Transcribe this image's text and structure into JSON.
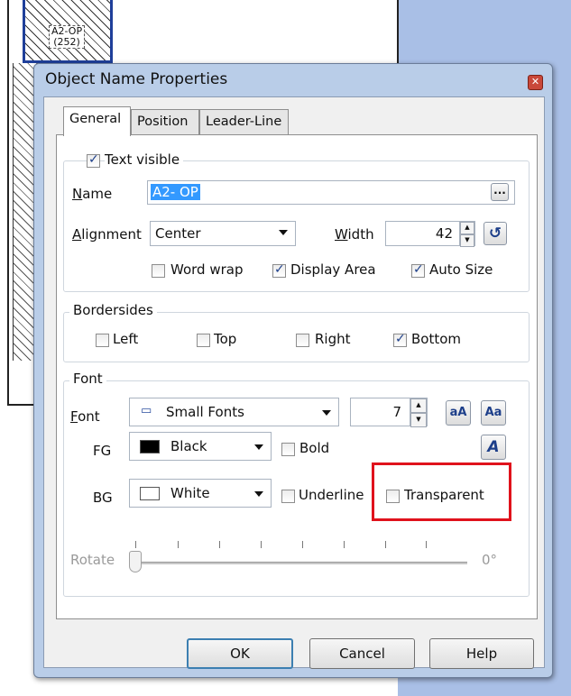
{
  "background": {
    "room_label_line1": "A2-OP",
    "room_label_line2": "(252)"
  },
  "dialog": {
    "title": "Object Name Properties",
    "close_icon": "close-icon"
  },
  "tabs": [
    {
      "label": "General",
      "active": true
    },
    {
      "label": "Position",
      "active": false
    },
    {
      "label": "Leader-Line",
      "active": false
    }
  ],
  "text_group": {
    "text_visible_label": "Text visible",
    "text_visible_checked": true,
    "name_label": "Name",
    "name_value": "A2- OP",
    "browse_label": "...",
    "alignment_label": "Alignment",
    "alignment_value": "Center",
    "width_label": "Width",
    "width_value": "42",
    "reset_icon": "refresh-icon",
    "word_wrap_label": "Word wrap",
    "word_wrap_checked": false,
    "display_area_label": "Display Area",
    "display_area_checked": true,
    "auto_size_label": "Auto Size",
    "auto_size_checked": true
  },
  "bordersides": {
    "title": "Bordersides",
    "left_label": "Left",
    "left_checked": false,
    "top_label": "Top",
    "top_checked": false,
    "right_label": "Right",
    "right_checked": false,
    "bottom_label": "Bottom",
    "bottom_checked": true
  },
  "font_group": {
    "title": "Font",
    "font_label": "Font",
    "font_value": "Small Fonts",
    "font_icon": "font-icon",
    "size_value": "7",
    "grow_icon": "font-grow-icon",
    "shrink_icon": "font-shrink-icon",
    "italic_icon": "font-style-icon",
    "fg_label": "FG",
    "fg_value": "Black",
    "fg_color": "#000000",
    "bold_label": "Bold",
    "bold_checked": false,
    "bg_label": "BG",
    "bg_value": "White",
    "bg_color": "#ffffff",
    "underline_label": "Underline",
    "underline_checked": false,
    "transparent_label": "Transparent",
    "transparent_checked": false,
    "highlight_color": "#e0121c"
  },
  "rotate": {
    "label": "Rotate",
    "value": "0°",
    "level": 0
  },
  "buttons": {
    "ok": "OK",
    "cancel": "Cancel",
    "help": "Help"
  }
}
